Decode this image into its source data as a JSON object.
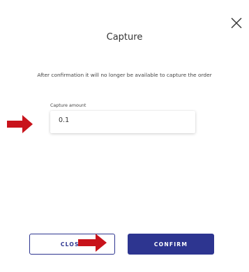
{
  "dialog": {
    "title": "Capture",
    "description": "After confirmation it will no longer be available to capture the order",
    "close_icon": "close-x-icon"
  },
  "capture_amount": {
    "label": "Capture amount",
    "value": "0.1"
  },
  "buttons": {
    "close_label": "CLOSE",
    "confirm_label": "CONFIRM"
  },
  "annotations": {
    "arrow_icon": "red-arrow-icon",
    "arrow_color": "#c8131b"
  },
  "colors": {
    "primary": "#2d3590",
    "background": "#ffffff",
    "text": "#333333"
  }
}
